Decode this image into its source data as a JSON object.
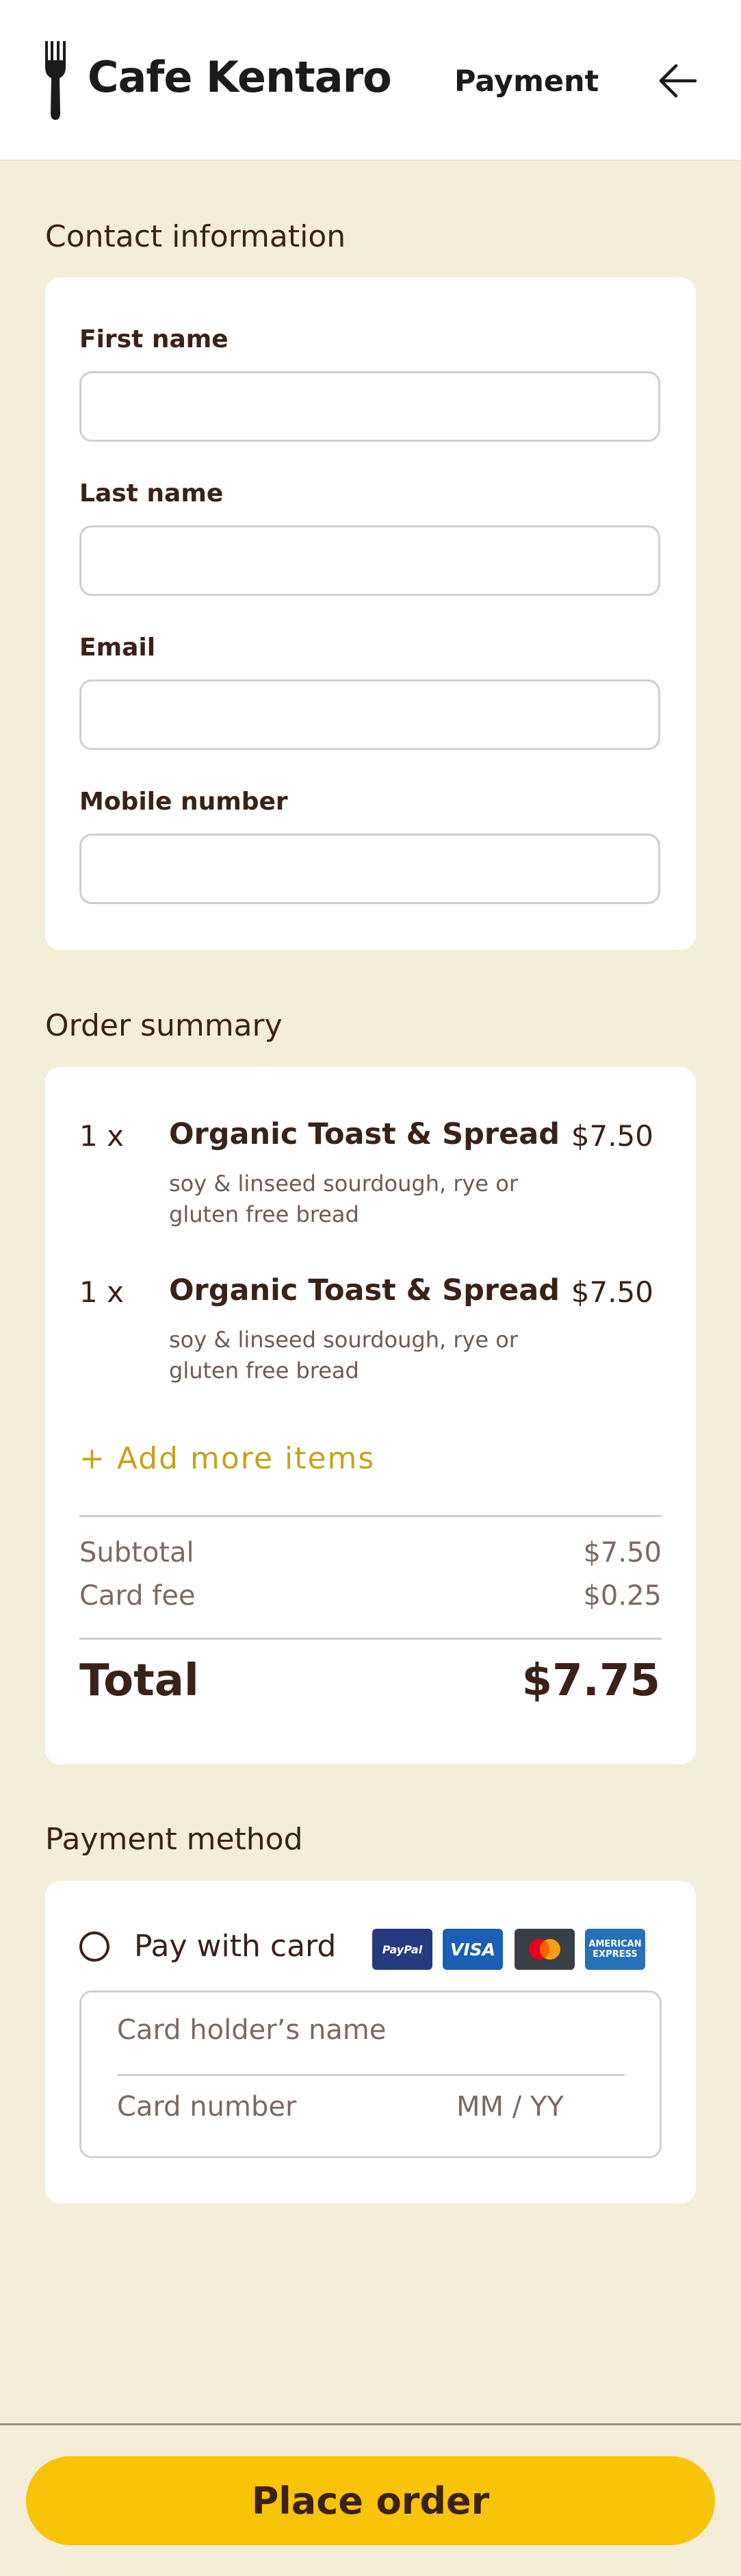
{
  "header": {
    "brand": "Cafe Kentaro",
    "page_title": "Payment",
    "logo_icon": "fork-icon",
    "back_icon": "arrow-left-icon"
  },
  "contact": {
    "section_title": "Contact information",
    "fields": [
      {
        "label": "First name",
        "value": ""
      },
      {
        "label": "Last name",
        "value": ""
      },
      {
        "label": "Email",
        "value": ""
      },
      {
        "label": "Mobile number",
        "value": ""
      }
    ]
  },
  "order": {
    "section_title": "Order summary",
    "items": [
      {
        "qty": "1 x",
        "name": "Organic Toast & Spread",
        "price": "$7.50",
        "desc": "soy & linseed sourdough, rye or gluten free bread"
      },
      {
        "qty": "1 x",
        "name": "Organic Toast & Spread",
        "price": "$7.50",
        "desc": "soy & linseed sourdough, rye or gluten free bread"
      }
    ],
    "add_more": "+ Add more items",
    "subtotal_label": "Subtotal",
    "subtotal_value": "$7.50",
    "fee_label": "Card fee",
    "fee_value": "$0.25",
    "total_label": "Total",
    "total_value": "$7.75"
  },
  "payment": {
    "section_title": "Payment method",
    "option_label": "Pay with card",
    "logos": {
      "paypal": "PayPal",
      "visa": "VISA",
      "mastercard": "mastercard-icon",
      "amex_line1": "AMERICAN",
      "amex_line2": "EXPRESS"
    },
    "card_holder_placeholder": "Card holder’s name",
    "card_number_placeholder": "Card number",
    "expiry_placeholder": "MM / YY"
  },
  "footer": {
    "button_label": "Place order"
  },
  "colors": {
    "background": "#f4edd8",
    "text": "#3a2217",
    "accent": "#f9c408",
    "link": "#c4a41d"
  }
}
